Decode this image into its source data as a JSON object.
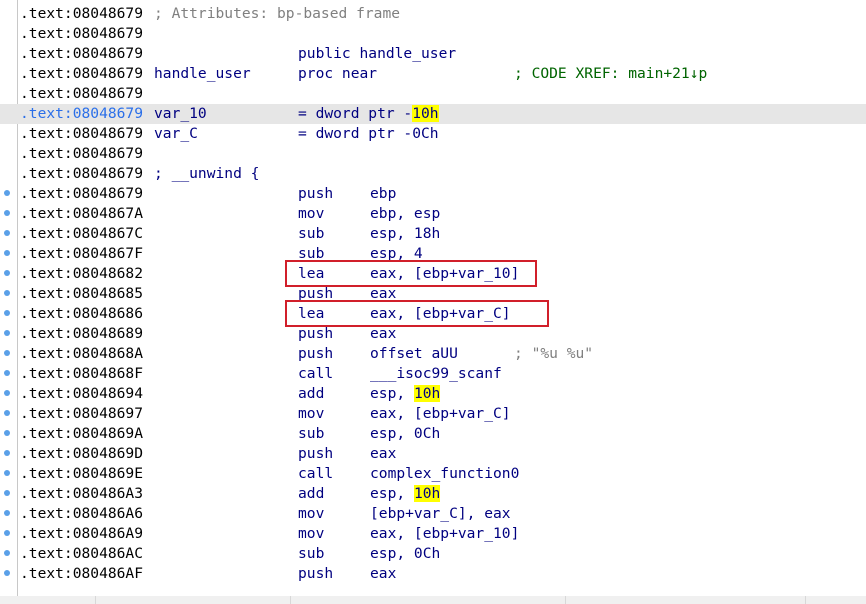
{
  "listing": {
    "lines": [
      {
        "addr": ".text:08048679",
        "kind": "header",
        "comment": "; Attributes: bp-based frame"
      },
      {
        "addr": ".text:08048679",
        "kind": "blank"
      },
      {
        "addr": ".text:08048679",
        "kind": "full",
        "text": "public handle_user"
      },
      {
        "addr": ".text:08048679",
        "kind": "proc",
        "label": "handle_user",
        "text": "proc near",
        "xref": "; CODE XREF: main+21↓p"
      },
      {
        "addr": ".text:08048679",
        "kind": "blank"
      },
      {
        "addr": ".text:08048679",
        "kind": "var",
        "label": "var_10",
        "pre": "= dword ptr -",
        "hl": "10h",
        "post": "",
        "current": true
      },
      {
        "addr": ".text:08048679",
        "kind": "var",
        "label": "var_C",
        "pre": "= dword ptr -0Ch",
        "hl": "",
        "post": ""
      },
      {
        "addr": ".text:08048679",
        "kind": "blank"
      },
      {
        "addr": ".text:08048679",
        "kind": "unwind",
        "text": "; __unwind {"
      },
      {
        "addr": ".text:08048679",
        "kind": "ins",
        "dot": true,
        "mnem": "push",
        "pre": "ebp",
        "hl": "",
        "post": ""
      },
      {
        "addr": ".text:0804867A",
        "kind": "ins",
        "dot": true,
        "mnem": "mov",
        "pre": "ebp, esp",
        "hl": "",
        "post": ""
      },
      {
        "addr": ".text:0804867C",
        "kind": "ins",
        "dot": true,
        "mnem": "sub",
        "pre": "esp, 18h",
        "hl": "",
        "post": ""
      },
      {
        "addr": ".text:0804867F",
        "kind": "ins",
        "dot": true,
        "mnem": "sub",
        "pre": "esp, 4",
        "hl": "",
        "post": ""
      },
      {
        "addr": ".text:08048682",
        "kind": "ins",
        "dot": true,
        "mnem": "lea",
        "pre": "eax, [ebp+var_10]",
        "hl": "",
        "post": ""
      },
      {
        "addr": ".text:08048685",
        "kind": "ins",
        "dot": true,
        "mnem": "push",
        "pre": "eax",
        "hl": "",
        "post": ""
      },
      {
        "addr": ".text:08048686",
        "kind": "ins",
        "dot": true,
        "mnem": "lea",
        "pre": "eax, [ebp+var_C]",
        "hl": "",
        "post": ""
      },
      {
        "addr": ".text:08048689",
        "kind": "ins",
        "dot": true,
        "mnem": "push",
        "pre": "eax",
        "hl": "",
        "post": ""
      },
      {
        "addr": ".text:0804868A",
        "kind": "ins",
        "dot": true,
        "mnem": "push",
        "pre": "offset aUU",
        "hl": "",
        "post": "",
        "comment": "; \"%u %u\""
      },
      {
        "addr": ".text:0804868F",
        "kind": "ins",
        "dot": true,
        "mnem": "call",
        "pre": "___isoc99_scanf",
        "hl": "",
        "post": ""
      },
      {
        "addr": ".text:08048694",
        "kind": "ins",
        "dot": true,
        "mnem": "add",
        "pre": "esp, ",
        "hl": "10h",
        "post": ""
      },
      {
        "addr": ".text:08048697",
        "kind": "ins",
        "dot": true,
        "mnem": "mov",
        "pre": "eax, [ebp+var_C]",
        "hl": "",
        "post": ""
      },
      {
        "addr": ".text:0804869A",
        "kind": "ins",
        "dot": true,
        "mnem": "sub",
        "pre": "esp, 0Ch",
        "hl": "",
        "post": ""
      },
      {
        "addr": ".text:0804869D",
        "kind": "ins",
        "dot": true,
        "mnem": "push",
        "pre": "eax",
        "hl": "",
        "post": ""
      },
      {
        "addr": ".text:0804869E",
        "kind": "ins",
        "dot": true,
        "mnem": "call",
        "pre": "complex_function0",
        "hl": "",
        "post": ""
      },
      {
        "addr": ".text:080486A3",
        "kind": "ins",
        "dot": true,
        "mnem": "add",
        "pre": "esp, ",
        "hl": "10h",
        "post": ""
      },
      {
        "addr": ".text:080486A6",
        "kind": "ins",
        "dot": true,
        "mnem": "mov",
        "pre": "[ebp+var_C], eax",
        "hl": "",
        "post": ""
      },
      {
        "addr": ".text:080486A9",
        "kind": "ins",
        "dot": true,
        "mnem": "mov",
        "pre": "eax, [ebp+var_10]",
        "hl": "",
        "post": ""
      },
      {
        "addr": ".text:080486AC",
        "kind": "ins",
        "dot": true,
        "mnem": "sub",
        "pre": "esp, 0Ch",
        "hl": "",
        "post": ""
      },
      {
        "addr": ".text:080486AF",
        "kind": "ins",
        "dot": true,
        "mnem": "push",
        "pre": "eax",
        "hl": "",
        "post": ""
      }
    ],
    "boxed_addresses": [
      ".text:08048682",
      ".text:08048686"
    ]
  },
  "colors": {
    "address": "#000000",
    "current_address": "#2a6ee8",
    "code": "#000080",
    "comment": "#808080",
    "xref": "#006400",
    "highlight": "#ffff00",
    "current_line": "#e6e6e6",
    "box": "#d11f2a",
    "dot": "#5aa0e8"
  }
}
